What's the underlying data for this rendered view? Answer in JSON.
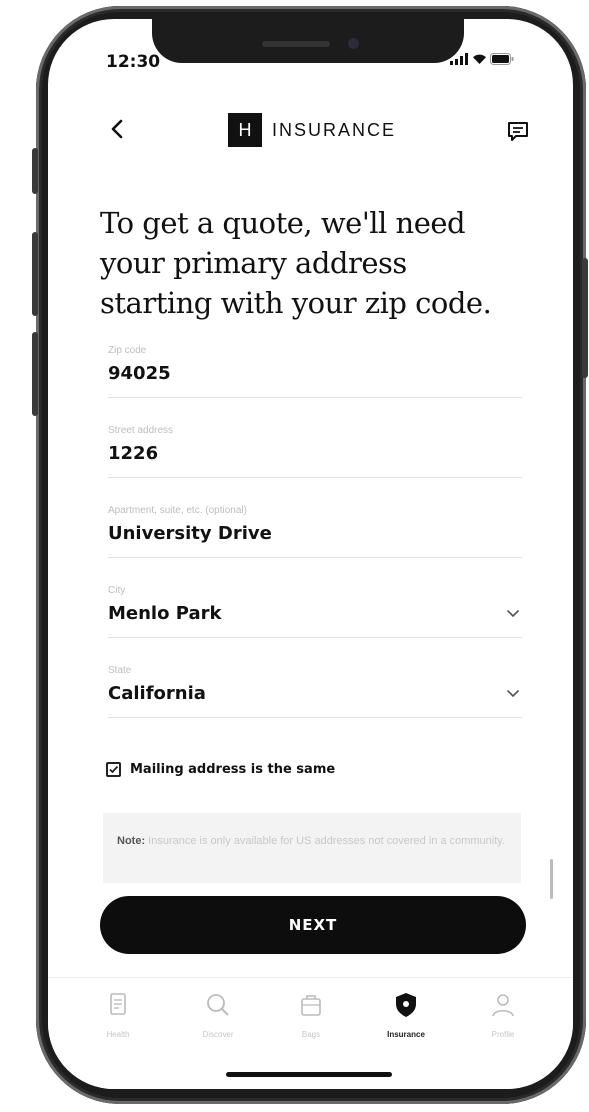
{
  "status": {
    "time": "12:30",
    "icons": [
      "signal-icon",
      "wifi-icon",
      "battery-icon"
    ]
  },
  "header": {
    "back_icon": "chevron-left-icon",
    "brand_mark": "H",
    "brand_text": "INSURANCE",
    "chat_icon": "chat-icon"
  },
  "headline": "To get a quote, we'll need your primary address starting with your zip code.",
  "form": {
    "zip": {
      "label": "Zip code",
      "value": "94025"
    },
    "street": {
      "label": "Street address",
      "value": "1226"
    },
    "apartment": {
      "label": "Apartment, suite, etc. (optional)",
      "value": "University Drive"
    },
    "city": {
      "label": "City",
      "value": "Menlo Park"
    },
    "state": {
      "label": "State",
      "value": "California"
    }
  },
  "mailing": {
    "label": "Mailing address is the same",
    "checked": true
  },
  "note": {
    "prefix": "Note:",
    "text": "Insurance is only available for US addresses not covered in a community."
  },
  "next_button": "NEXT",
  "tabs": [
    {
      "label": "Health",
      "icon": "document-icon",
      "active": false
    },
    {
      "label": "Discover",
      "icon": "search-icon",
      "active": false
    },
    {
      "label": "Bags",
      "icon": "bag-icon",
      "active": false
    },
    {
      "label": "Insurance",
      "icon": "shield-icon",
      "active": true
    },
    {
      "label": "Profile",
      "icon": "profile-icon",
      "active": false
    }
  ],
  "colors": {
    "primary": "#0d0d0d",
    "muted": "#c6c6c6",
    "divider": "#e3e3e3"
  }
}
